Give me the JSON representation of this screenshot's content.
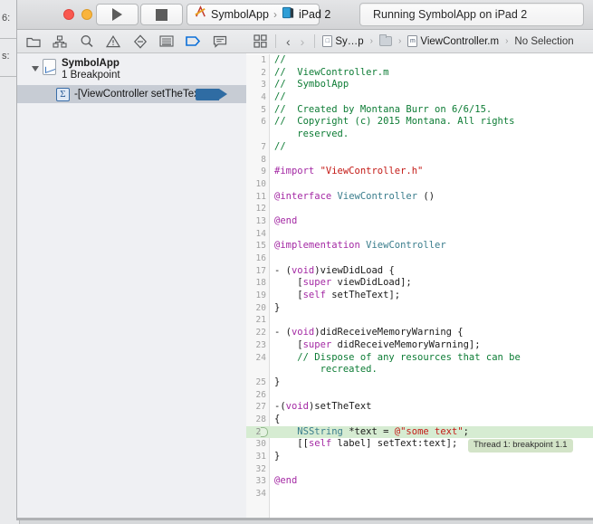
{
  "background_window": {
    "fragment_top": "6:",
    "fragment_bottom": "s:"
  },
  "toolbar": {
    "window_controls": [
      "close",
      "minimize",
      "zoom"
    ],
    "run_button_label": "Run",
    "stop_button_label": "Stop",
    "scheme_name": "SymbolApp",
    "destination_name": "iPad 2",
    "separator": "›",
    "status_text": "Running SymbolApp on iPad 2"
  },
  "navigator": {
    "icons": [
      "folder-icon",
      "symbol-hierarchy-icon",
      "search-icon",
      "warning-icon",
      "test-icon",
      "debug-icon",
      "breakpoint-icon",
      "report-icon"
    ],
    "selected_icon": "breakpoint-icon",
    "group": {
      "title": "SymbolApp",
      "subtitle": "1 Breakpoint"
    },
    "breakpoints": [
      {
        "label": "-[ViewController setTheText]",
        "symbol": "Σ",
        "enabled": true
      }
    ]
  },
  "editor": {
    "jump_bar": {
      "back_chevron": "‹",
      "forward_chevron": "›",
      "project": "Sy…p",
      "folder": "",
      "file": "ViewController.m",
      "file_badge": "m",
      "selection": "No Selection",
      "caret": "›"
    },
    "highlighted_line": 29,
    "annotation": "Thread 1: breakpoint 1.1",
    "lines": [
      {
        "n": 1,
        "tokens": [
          {
            "t": "//",
            "c": "c-comment"
          }
        ]
      },
      {
        "n": 2,
        "tokens": [
          {
            "t": "//  ViewController.m",
            "c": "c-comment"
          }
        ]
      },
      {
        "n": 3,
        "tokens": [
          {
            "t": "//  SymbolApp",
            "c": "c-comment"
          }
        ]
      },
      {
        "n": 4,
        "tokens": [
          {
            "t": "//",
            "c": "c-comment"
          }
        ]
      },
      {
        "n": 5,
        "tokens": [
          {
            "t": "//  Created by Montana Burr on 6/6/15.",
            "c": "c-comment"
          }
        ]
      },
      {
        "n": 6,
        "tokens": [
          {
            "t": "//  Copyright (c) 2015 Montana. All rights",
            "c": "c-comment"
          }
        ]
      },
      {
        "n": null,
        "tokens": [
          {
            "t": "    reserved.",
            "c": "c-comment"
          }
        ]
      },
      {
        "n": 7,
        "tokens": [
          {
            "t": "//",
            "c": "c-comment"
          }
        ]
      },
      {
        "n": 8,
        "tokens": []
      },
      {
        "n": 9,
        "tokens": [
          {
            "t": "#import ",
            "c": "c-pre"
          },
          {
            "t": "\"ViewController.h\"",
            "c": "c-str"
          }
        ]
      },
      {
        "n": 10,
        "tokens": []
      },
      {
        "n": 11,
        "tokens": [
          {
            "t": "@interface ",
            "c": "c-kw"
          },
          {
            "t": "ViewController",
            "c": "c-type"
          },
          {
            "t": " ()",
            "c": "c-plain"
          }
        ]
      },
      {
        "n": 12,
        "tokens": []
      },
      {
        "n": 13,
        "tokens": [
          {
            "t": "@end",
            "c": "c-kw"
          }
        ]
      },
      {
        "n": 14,
        "tokens": []
      },
      {
        "n": 15,
        "tokens": [
          {
            "t": "@implementation ",
            "c": "c-kw"
          },
          {
            "t": "ViewController",
            "c": "c-type"
          }
        ]
      },
      {
        "n": 16,
        "tokens": []
      },
      {
        "n": 17,
        "tokens": [
          {
            "t": "- (",
            "c": "c-plain"
          },
          {
            "t": "void",
            "c": "c-kw"
          },
          {
            "t": ")viewDidLoad {",
            "c": "c-plain"
          }
        ]
      },
      {
        "n": 18,
        "tokens": [
          {
            "t": "    [",
            "c": "c-plain"
          },
          {
            "t": "super",
            "c": "c-self"
          },
          {
            "t": " viewDidLoad];",
            "c": "c-plain"
          }
        ]
      },
      {
        "n": 19,
        "tokens": [
          {
            "t": "    [",
            "c": "c-plain"
          },
          {
            "t": "self",
            "c": "c-self"
          },
          {
            "t": " setTheText];",
            "c": "c-plain"
          }
        ]
      },
      {
        "n": 20,
        "tokens": [
          {
            "t": "}",
            "c": "c-plain"
          }
        ]
      },
      {
        "n": 21,
        "tokens": []
      },
      {
        "n": 22,
        "tokens": [
          {
            "t": "- (",
            "c": "c-plain"
          },
          {
            "t": "void",
            "c": "c-kw"
          },
          {
            "t": ")didReceiveMemoryWarning {",
            "c": "c-plain"
          }
        ]
      },
      {
        "n": 23,
        "tokens": [
          {
            "t": "    [",
            "c": "c-plain"
          },
          {
            "t": "super",
            "c": "c-self"
          },
          {
            "t": " didReceiveMemoryWarning];",
            "c": "c-plain"
          }
        ]
      },
      {
        "n": 24,
        "tokens": [
          {
            "t": "    // Dispose of any resources that can be",
            "c": "c-comment"
          }
        ]
      },
      {
        "n": null,
        "tokens": [
          {
            "t": "        recreated.",
            "c": "c-comment"
          }
        ]
      },
      {
        "n": 25,
        "tokens": [
          {
            "t": "}",
            "c": "c-plain"
          }
        ]
      },
      {
        "n": 26,
        "tokens": []
      },
      {
        "n": 27,
        "tokens": [
          {
            "t": "-(",
            "c": "c-plain"
          },
          {
            "t": "void",
            "c": "c-kw"
          },
          {
            "t": ")setTheText",
            "c": "c-plain"
          }
        ]
      },
      {
        "n": 28,
        "tokens": [
          {
            "t": "{",
            "c": "c-plain"
          }
        ]
      },
      {
        "n": 29,
        "tokens": [
          {
            "t": "    ",
            "c": "c-plain"
          },
          {
            "t": "NSString",
            "c": "c-type"
          },
          {
            "t": " *text = ",
            "c": "c-plain"
          },
          {
            "t": "@\"some text\"",
            "c": "c-str"
          },
          {
            "t": ";",
            "c": "c-plain"
          }
        ],
        "highlight": true
      },
      {
        "n": 30,
        "tokens": [
          {
            "t": "    [[",
            "c": "c-plain"
          },
          {
            "t": "self",
            "c": "c-self"
          },
          {
            "t": " label] setText:text];",
            "c": "c-plain"
          }
        ],
        "annotated": true
      },
      {
        "n": 31,
        "tokens": [
          {
            "t": "}",
            "c": "c-plain"
          }
        ]
      },
      {
        "n": 32,
        "tokens": []
      },
      {
        "n": 33,
        "tokens": [
          {
            "t": "@end",
            "c": "c-kw"
          }
        ]
      },
      {
        "n": 34,
        "tokens": []
      }
    ]
  },
  "colors": {
    "accent_blue": "#2f6ca3",
    "highlight_green": "#d6ecd2",
    "bubble_green": "#d3e4c8",
    "comment_green": "#0d7c35",
    "string_red": "#c41a16",
    "keyword_magenta": "#a429a4",
    "type_teal": "#3a7d8c"
  }
}
